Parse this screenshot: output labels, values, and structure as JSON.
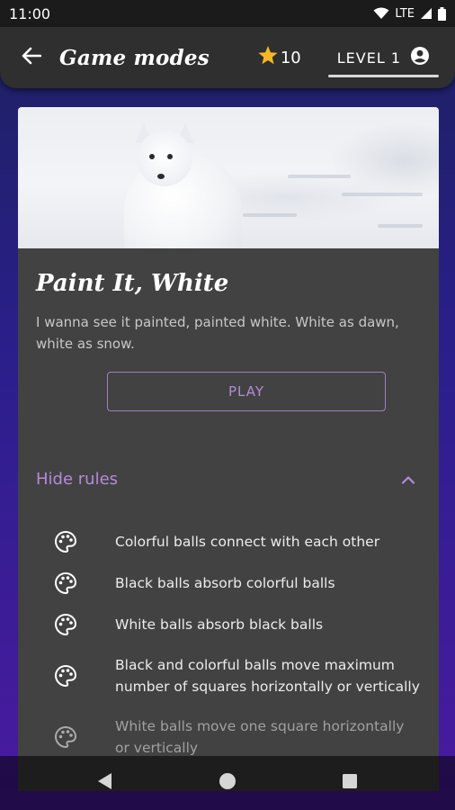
{
  "status_bar": {
    "time": "11:00",
    "network": "LTE",
    "icons": [
      "wifi-icon",
      "signal-icon",
      "battery-icon"
    ]
  },
  "app_bar": {
    "back_icon": "arrow-left-icon",
    "title": "Game modes",
    "stars_count": "10",
    "star_icon": "star-icon",
    "level_label": "LEVEL 1",
    "account_icon": "account-circle-icon"
  },
  "mode": {
    "image": "arctic-fox-in-snow",
    "title": "Paint It, White",
    "description": "I wanna see it painted, painted white. White as dawn, white as snow.",
    "play_label": "PLAY"
  },
  "rules": {
    "toggle_label": "Hide rules",
    "toggle_icon": "chevron-up-icon",
    "item_icon": "palette-icon",
    "items": [
      "Colorful balls connect with each other",
      "Black balls absorb colorful balls",
      "White balls absorb black balls",
      "Black and colorful balls move maximum number of squares horizontally or vertically",
      "White balls move one square horizontally or vertically"
    ]
  },
  "nav_bar": {
    "icons": [
      "back-triangle-icon",
      "home-circle-icon",
      "recents-square-icon"
    ]
  },
  "colors": {
    "accent": "#b48adc",
    "app_bar": "#2f2f2f",
    "card": "#424242",
    "star": "#f5b727",
    "background_top": "#1c2060",
    "background_bottom": "#4a1aa0"
  }
}
